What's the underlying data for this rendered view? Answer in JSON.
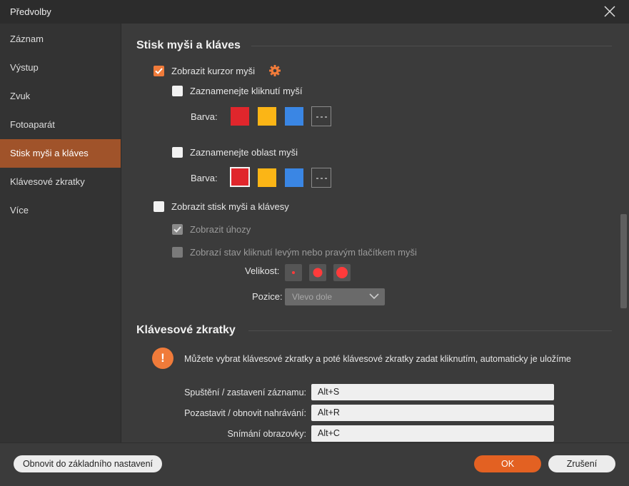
{
  "window": {
    "title": "Předvolby"
  },
  "sidebar": {
    "items": [
      {
        "label": "Záznam"
      },
      {
        "label": "Výstup"
      },
      {
        "label": "Zvuk"
      },
      {
        "label": "Fotoaparát"
      },
      {
        "label": "Stisk myši a kláves",
        "active": true
      },
      {
        "label": "Klávesové zkratky"
      },
      {
        "label": "Více"
      }
    ]
  },
  "mouse_section": {
    "title": "Stisk myši a kláves",
    "show_cursor": {
      "label": "Zobrazit kurzor myši",
      "checked": true
    },
    "record_clicks": {
      "label": "Zaznamenejte kliknutí myší",
      "checked": false
    },
    "color_label_1": "Barva:",
    "record_area": {
      "label": "Zaznamenejte oblast myši",
      "checked": false
    },
    "color_label_2": "Barva:",
    "show_keystrokes": {
      "label": "Zobrazit stisk myši a klávesy",
      "checked": false
    },
    "show_strokes": {
      "label": "Zobrazit úhozy",
      "checked": true
    },
    "show_click_state": {
      "label": "Zobrazí stav kliknutí levým nebo pravým tlačítkem myši",
      "checked": false
    },
    "size_label": "Velikost:",
    "position_label": "Pozice:",
    "position_value": "Vlevo dole"
  },
  "colors": {
    "red": "#e0262c",
    "yellow": "#fbb516",
    "blue": "#3a86e4",
    "accent": "#f07b3a"
  },
  "shortcuts_section": {
    "title": "Klávesové zkratky",
    "info": "Můžete vybrat klávesové zkratky a poté klávesové zkratky zadat kliknutím, automaticky je uložíme",
    "rows": [
      {
        "label": "Spuštění / zastavení záznamu:",
        "value": "Alt+S"
      },
      {
        "label": "Pozastavit / obnovit nahrávání:",
        "value": "Alt+R"
      },
      {
        "label": "Snímání obrazovky:",
        "value": "Alt+C"
      }
    ]
  },
  "footer": {
    "reset_label": "Obnovit do základního nastavení",
    "ok_label": "OK",
    "cancel_label": "Zrušení"
  }
}
